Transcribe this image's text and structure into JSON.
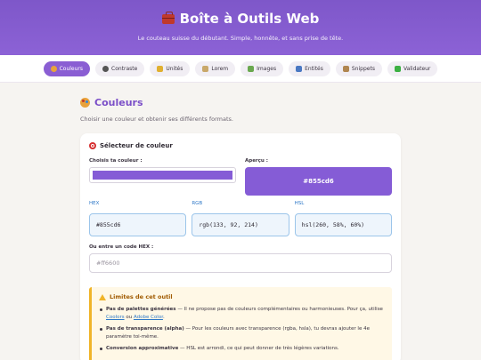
{
  "hero": {
    "title": "Boîte à Outils Web",
    "subtitle": "Le couteau suisse du débutant. Simple, honnête, et sans prise de tête."
  },
  "nav": {
    "tabs": [
      {
        "label": "Couleurs",
        "icon": "palette-icon",
        "icon_color": "#e8a23b"
      },
      {
        "label": "Contraste",
        "icon": "eye-icon",
        "icon_color": "#555555"
      },
      {
        "label": "Unités",
        "icon": "ruler-icon",
        "icon_color": "#e0b030"
      },
      {
        "label": "Lorem",
        "icon": "memo-icon",
        "icon_color": "#c9a86a"
      },
      {
        "label": "Images",
        "icon": "image-icon",
        "icon_color": "#6aa84f"
      },
      {
        "label": "Entités",
        "icon": "numbers-icon",
        "icon_color": "#4a78c2"
      },
      {
        "label": "Snippets",
        "icon": "clipboard-icon",
        "icon_color": "#b08650"
      },
      {
        "label": "Validateur",
        "icon": "check-icon",
        "icon_color": "#3cb043"
      }
    ]
  },
  "section": {
    "title": "Couleurs",
    "description": "Choisir une couleur et obtenir ses différents formats."
  },
  "card": {
    "title": "Sélecteur de couleur",
    "picker_label": "Choisis ta couleur :",
    "preview_label": "Aperçu :",
    "preview_value": "#855cd6",
    "selected_color": "#855cd6",
    "formats": [
      {
        "label": "HEX",
        "value": "#855cd6"
      },
      {
        "label": "RGB",
        "value": "rgb(133, 92, 214)"
      },
      {
        "label": "HSL",
        "value": "hsl(260, 58%, 60%)"
      }
    ],
    "hex_input_label": "Ou entre un code HEX :",
    "hex_input_placeholder": "#ff6600"
  },
  "limits": {
    "title": "Limites de cet outil",
    "items": [
      {
        "bold": "Pas de palettes générées",
        "text_before": " — Il ne propose pas de couleurs complémentaires ou harmonieuses. Pour ça, utilise ",
        "link1": "Coolors",
        "middle": " ou ",
        "link2": "Adobe Color",
        "text_after": "."
      },
      {
        "bold": "Pas de transparence (alpha)",
        "text": " — Pour les couleurs avec transparence (rgba, hsla), tu devras ajouter le 4e paramètre toi-même."
      },
      {
        "bold": "Conversion approximative",
        "text": " — HSL est arrondi, ce qui peut donner de très légères variations."
      }
    ]
  },
  "colors": {
    "accent": "#8a5ed3",
    "hero_bg": "#7e57c9"
  }
}
